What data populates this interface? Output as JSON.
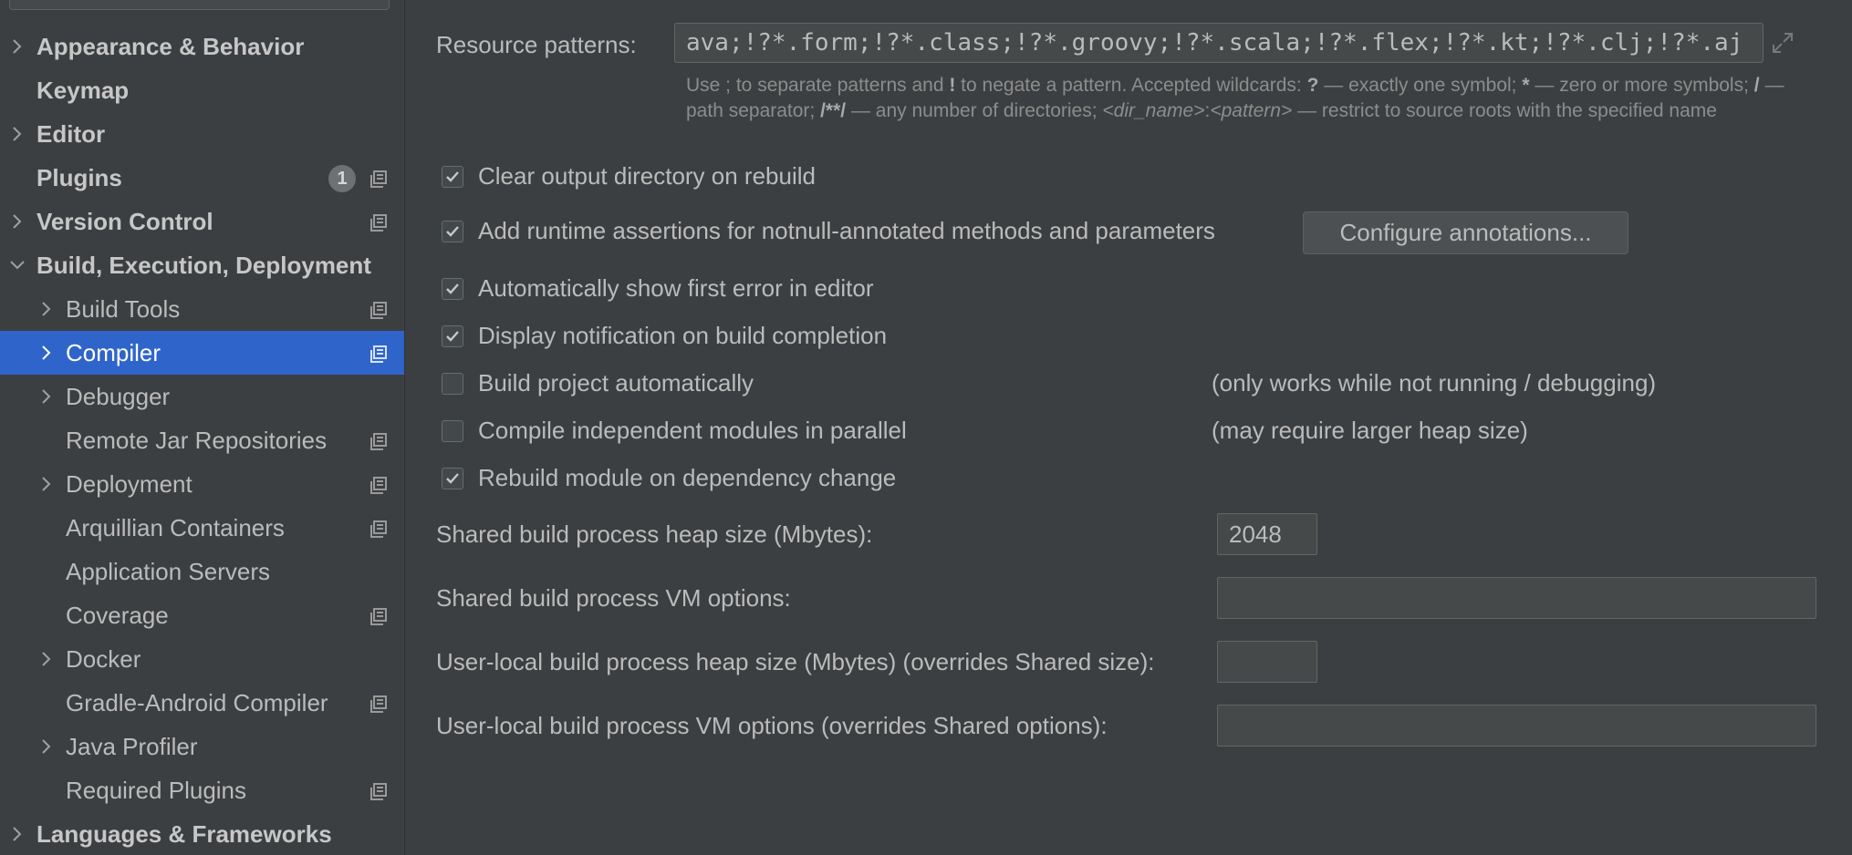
{
  "sidebar": {
    "items": [
      {
        "label": "Appearance & Behavior",
        "expandable": true
      },
      {
        "label": "Keymap"
      },
      {
        "label": "Editor",
        "expandable": true
      },
      {
        "label": "Plugins",
        "badge": "1"
      },
      {
        "label": "Version Control",
        "expandable": true
      },
      {
        "label": "Build, Execution, Deployment",
        "expanded": true
      },
      {
        "label": "Build Tools"
      },
      {
        "label": "Compiler",
        "selected": true
      },
      {
        "label": "Debugger"
      },
      {
        "label": "Remote Jar Repositories"
      },
      {
        "label": "Deployment"
      },
      {
        "label": "Arquillian Containers"
      },
      {
        "label": "Application Servers"
      },
      {
        "label": "Coverage"
      },
      {
        "label": "Docker"
      },
      {
        "label": "Gradle-Android Compiler"
      },
      {
        "label": "Java Profiler"
      },
      {
        "label": "Required Plugins"
      },
      {
        "label": "Languages & Frameworks",
        "expandable": true
      }
    ]
  },
  "compiler": {
    "resource_patterns_label": "Resource patterns:",
    "resource_patterns_value": "ava;!?*.form;!?*.class;!?*.groovy;!?*.scala;!?*.flex;!?*.kt;!?*.clj;!?*.aj",
    "hint": {
      "t1": "Use ; to separate patterns and ",
      "b1": "!",
      "t2": " to negate a pattern. Accepted wildcards: ",
      "b2": "?",
      "t3": " — exactly one symbol; ",
      "b3": "*",
      "t4": " — zero or more symbols; ",
      "b4": "/",
      "t5": " — path separator; ",
      "b5": "/**/",
      "t6": " — any number of directories; ",
      "i1": "<dir_name>",
      "t7": ":",
      "i2": "<pattern>",
      "t8": " — restrict to source roots with the specified name"
    },
    "options": [
      {
        "label": "Clear output directory on rebuild",
        "checked": true
      },
      {
        "label": "Add runtime assertions for notnull-annotated methods and parameters",
        "checked": true
      },
      {
        "label": "Automatically show first error in editor",
        "checked": true
      },
      {
        "label": "Display notification on build completion",
        "checked": true
      },
      {
        "label": "Build project automatically",
        "checked": false,
        "note": "(only works while not running / debugging)"
      },
      {
        "label": "Compile independent modules in parallel",
        "checked": false,
        "note": "(may require larger heap size)"
      },
      {
        "label": "Rebuild module on dependency change",
        "checked": true
      }
    ],
    "configure_annotations_button": "Configure annotations...",
    "fields": [
      {
        "label": "Shared build process heap size (Mbytes):",
        "value": "2048"
      },
      {
        "label": "Shared build process VM options:",
        "value": ""
      },
      {
        "label": "User-local build process heap size (Mbytes) (overrides Shared size):",
        "value": ""
      },
      {
        "label": "User-local build process VM options (overrides Shared options):",
        "value": ""
      }
    ]
  },
  "colors": {
    "background": "#3c3f41",
    "selection": "#2f65ca",
    "text": "#bbbbbb"
  }
}
